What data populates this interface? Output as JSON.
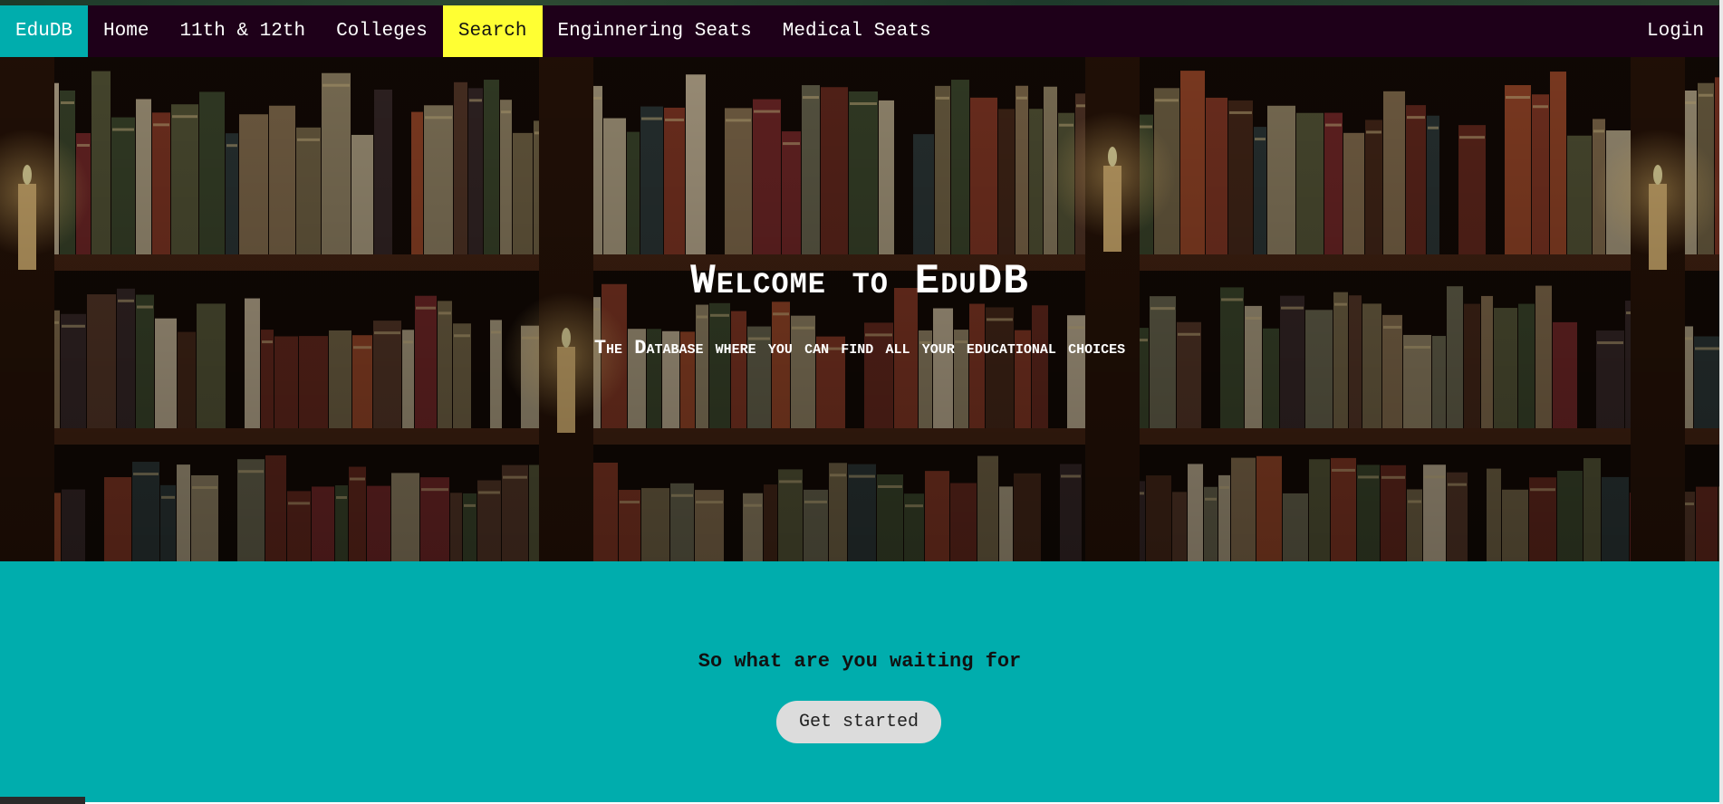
{
  "nav": {
    "brand": "EduDB",
    "items": [
      {
        "label": "Home"
      },
      {
        "label": "11th & 12th"
      },
      {
        "label": "Colleges"
      },
      {
        "label": "Search"
      },
      {
        "label": "Enginnering Seats"
      },
      {
        "label": "Medical Seats"
      }
    ],
    "active_item": "Search",
    "login": "Login"
  },
  "hero": {
    "title": "Welcome to EduDB",
    "subtitle": "The Database where you can find all your educational choices",
    "background": "bookshelf-image"
  },
  "cta": {
    "text": "So what are you waiting for",
    "button_label": "Get started"
  },
  "colors": {
    "navbar": "#1e0019",
    "brand": "#00adad",
    "active": "#ffff33",
    "cta_background": "#00adad",
    "button": "#dcdcdc"
  }
}
